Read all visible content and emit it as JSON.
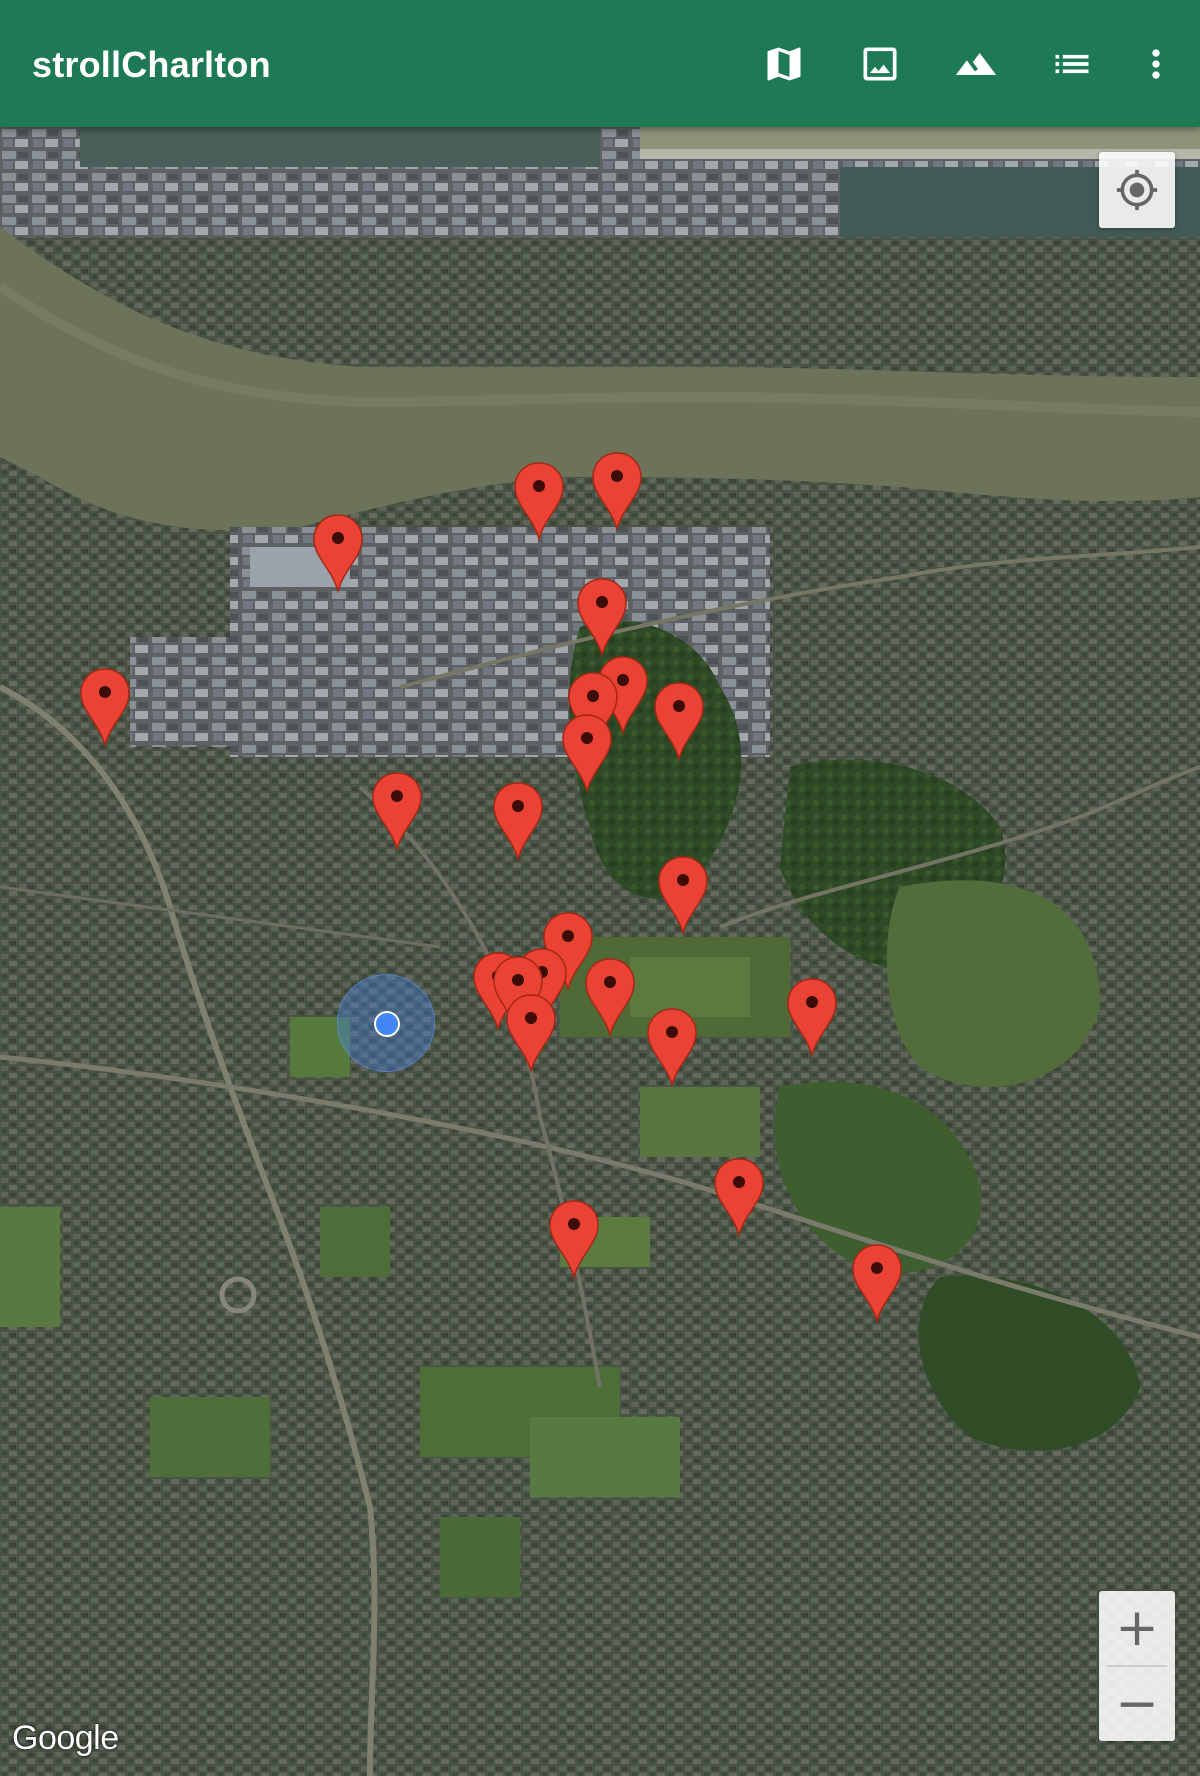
{
  "app_bar": {
    "title": "strollCharlton",
    "background": "#1e7a55",
    "actions": [
      "map-icon",
      "image-icon",
      "terrain-icon",
      "list-icon",
      "more-vert-icon"
    ]
  },
  "map": {
    "map_type": "satellite",
    "attribution": "Google",
    "controls": {
      "my_location": "my-location-icon",
      "zoom_in": "+",
      "zoom_out": "−"
    },
    "marker_color": "#ea4335",
    "marker_count": 22,
    "user_location_color": "#4285f4"
  }
}
